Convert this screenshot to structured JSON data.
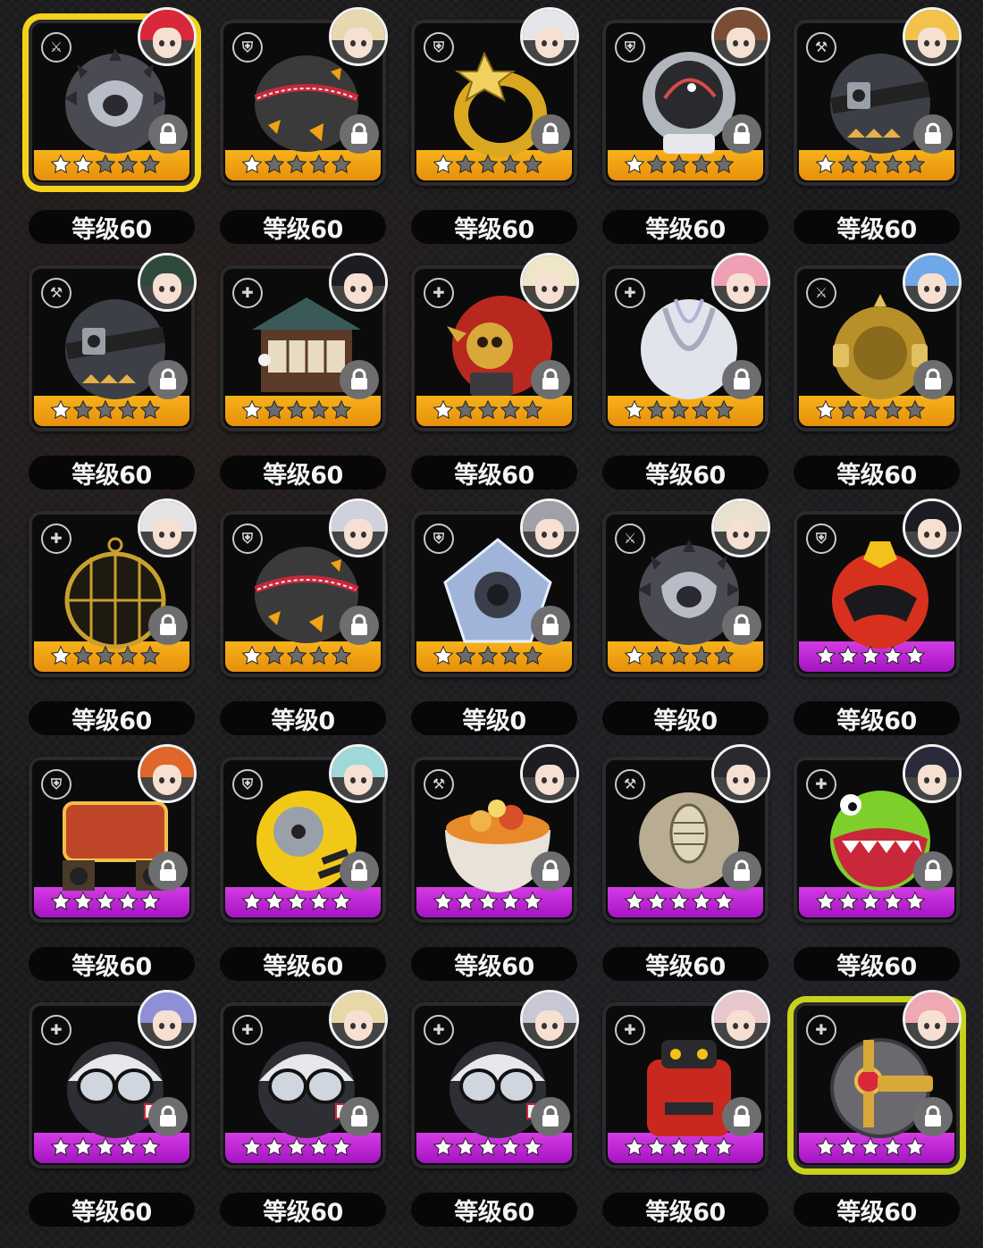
{
  "colors": {
    "rarity_orange": "#f2a214",
    "rarity_purple": "#c026d3",
    "highlight_gold": "#f4d21a",
    "highlight_lime": "#c6d21c",
    "star_filled": "#ffffff",
    "star_empty": "#6b6b6b"
  },
  "items": [
    {
      "level": "等级60",
      "stars": 2,
      "rarity": "orange",
      "type_icon": "attack-icon",
      "art": "spiked-black-ball",
      "art_color": "#4a4a52",
      "avatar_hair": "#d8283a",
      "selected": "gold",
      "locked": true
    },
    {
      "level": "等级60",
      "stars": 1,
      "rarity": "orange",
      "type_icon": "shield-icon",
      "art": "zipper-ball",
      "art_color": "#3a3a3a",
      "avatar_hair": "#e8d8b0",
      "selected": "",
      "locked": true
    },
    {
      "level": "等级60",
      "stars": 1,
      "rarity": "orange",
      "type_icon": "shield-icon",
      "art": "gold-ring",
      "art_color": "#d9a820",
      "avatar_hair": "#e6e6ea",
      "selected": "",
      "locked": true
    },
    {
      "level": "等级60",
      "stars": 1,
      "rarity": "orange",
      "type_icon": "shield-icon",
      "art": "glass-orb",
      "art_color": "#cfd4dc",
      "avatar_hair": "#7a4e34",
      "selected": "",
      "locked": true
    },
    {
      "level": "等级60",
      "stars": 1,
      "rarity": "orange",
      "type_icon": "hammer-icon",
      "art": "strapped-ball",
      "art_color": "#3d3f46",
      "avatar_hair": "#f2c24a",
      "selected": "",
      "locked": true
    },
    {
      "level": "等级60",
      "stars": 1,
      "rarity": "orange",
      "type_icon": "hammer-icon",
      "art": "strapped-ball",
      "art_color": "#3d3f46",
      "avatar_hair": "#2f4a3c",
      "selected": "",
      "locked": true
    },
    {
      "level": "等级60",
      "stars": 1,
      "rarity": "orange",
      "type_icon": "support-icon",
      "art": "house",
      "art_color": "#5b3a2a",
      "avatar_hair": "#1c1c22",
      "selected": "",
      "locked": true
    },
    {
      "level": "等级60",
      "stars": 1,
      "rarity": "orange",
      "type_icon": "support-icon",
      "art": "red-skull-ball",
      "art_color": "#b8281e",
      "avatar_hair": "#efe6c8",
      "selected": "",
      "locked": true
    },
    {
      "level": "等级60",
      "stars": 1,
      "rarity": "orange",
      "type_icon": "support-icon",
      "art": "white-shell",
      "art_color": "#e2e4ec",
      "avatar_hair": "#f0a0b4",
      "selected": "",
      "locked": true
    },
    {
      "level": "等级60",
      "stars": 1,
      "rarity": "orange",
      "type_icon": "attack-icon",
      "art": "gold-sphere",
      "art_color": "#b8902a",
      "avatar_hair": "#6fa8e8",
      "selected": "",
      "locked": true
    },
    {
      "level": "等级60",
      "stars": 1,
      "rarity": "orange",
      "type_icon": "support-icon",
      "art": "gold-cage",
      "art_color": "#c9a02e",
      "avatar_hair": "#e4e4e4",
      "selected": "",
      "locked": true
    },
    {
      "level": "等级0",
      "stars": 1,
      "rarity": "orange",
      "type_icon": "shield-icon",
      "art": "zipper-ball",
      "art_color": "#3a3a3a",
      "avatar_hair": "#cfd2dc",
      "selected": "",
      "locked": true
    },
    {
      "level": "等级0",
      "stars": 1,
      "rarity": "orange",
      "type_icon": "shield-icon",
      "art": "crystal-core",
      "art_color": "#9fb4d8",
      "avatar_hair": "#a0a0a8",
      "selected": "",
      "locked": true
    },
    {
      "level": "等级0",
      "stars": 1,
      "rarity": "orange",
      "type_icon": "attack-icon",
      "art": "spiked-black-ball",
      "art_color": "#4a4a52",
      "avatar_hair": "#eae0d0",
      "selected": "",
      "locked": true
    },
    {
      "level": "等级60",
      "stars": 5,
      "rarity": "purple",
      "type_icon": "shield-icon",
      "art": "red-helmet",
      "art_color": "#d8301e",
      "avatar_hair": "#1c1c24",
      "selected": "",
      "locked": false
    },
    {
      "level": "等级60",
      "stars": 5,
      "rarity": "purple",
      "type_icon": "shield-icon",
      "art": "desire-stage",
      "art_color": "#c0462a",
      "avatar_hair": "#e0662a",
      "selected": "",
      "locked": true
    },
    {
      "level": "等级60",
      "stars": 5,
      "rarity": "purple",
      "type_icon": "shield-icon",
      "art": "yellow-core",
      "art_color": "#f2c818",
      "avatar_hair": "#9fd8d8",
      "selected": "",
      "locked": true
    },
    {
      "level": "等级60",
      "stars": 5,
      "rarity": "purple",
      "type_icon": "hammer-icon",
      "art": "food-bowl",
      "art_color": "#e8e2d8",
      "avatar_hair": "#1c1c22",
      "selected": "",
      "locked": true
    },
    {
      "level": "等级60",
      "stars": 5,
      "rarity": "purple",
      "type_icon": "hammer-icon",
      "art": "fossil-rock",
      "art_color": "#b8ad92",
      "avatar_hair": "#2a2a2e",
      "selected": "",
      "locked": true
    },
    {
      "level": "等级60",
      "stars": 5,
      "rarity": "purple",
      "type_icon": "support-icon",
      "art": "green-monster",
      "art_color": "#7ecf2a",
      "avatar_hair": "#2a2a3a",
      "selected": "",
      "locked": true
    },
    {
      "level": "等级60",
      "stars": 5,
      "rarity": "purple",
      "type_icon": "support-icon",
      "art": "goggle-ball",
      "art_color": "#2e2f34",
      "avatar_hair": "#8f8fd8",
      "selected": "",
      "locked": true
    },
    {
      "level": "等级60",
      "stars": 5,
      "rarity": "purple",
      "type_icon": "support-icon",
      "art": "goggle-ball",
      "art_color": "#2e2f34",
      "avatar_hair": "#e8d8a8",
      "selected": "",
      "locked": true
    },
    {
      "level": "等级60",
      "stars": 5,
      "rarity": "purple",
      "type_icon": "support-icon",
      "art": "goggle-ball",
      "art_color": "#2e2f34",
      "avatar_hair": "#c8c8d4",
      "selected": "",
      "locked": true
    },
    {
      "level": "等级60",
      "stars": 5,
      "rarity": "purple",
      "type_icon": "support-icon",
      "art": "red-robot",
      "art_color": "#c8281e",
      "avatar_hair": "#e8c8cc",
      "selected": "",
      "locked": true
    },
    {
      "level": "等级60",
      "stars": 5,
      "rarity": "purple",
      "type_icon": "support-icon",
      "art": "gray-gear-ball",
      "art_color": "#6a6a6e",
      "avatar_hair": "#f0a8b4",
      "selected": "lime",
      "locked": true
    }
  ]
}
